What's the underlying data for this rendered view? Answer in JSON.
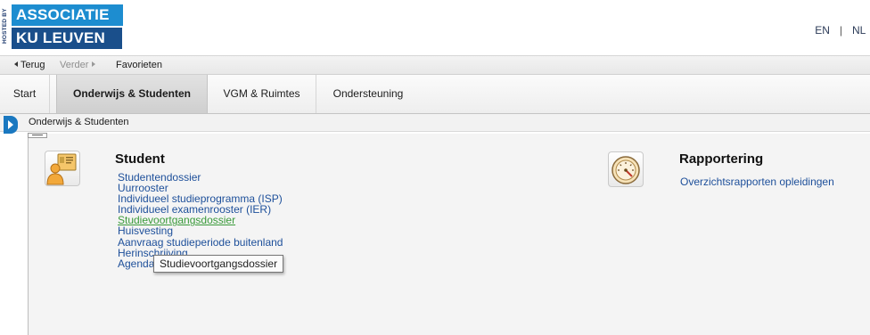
{
  "header": {
    "hosted_by": "HOSTED BY",
    "logo_line1": "ASSOCIATIE",
    "logo_line2": "KU LEUVEN",
    "languages": [
      "EN",
      "NL"
    ],
    "lang_separator": "|"
  },
  "navbar": {
    "back": "Terug",
    "forward": "Verder",
    "favorites": "Favorieten"
  },
  "tabs": [
    {
      "label": "Start",
      "active": false
    },
    {
      "label": "Onderwijs & Studenten",
      "active": true
    },
    {
      "label": "VGM & Ruimtes",
      "active": false
    },
    {
      "label": "Ondersteuning",
      "active": false
    }
  ],
  "breadcrumb": "Onderwijs & Studenten",
  "student": {
    "title": "Student",
    "icon": "student-badge-icon",
    "links": [
      "Studentendossier",
      "Uurrooster",
      "Individueel studieprogramma (ISP)",
      "Individueel examenrooster (IER)",
      "Studievoortgangsdossier",
      "Huisvesting",
      "Aanvraag studieperiode buitenland",
      "Herinschrijving",
      "Agenda sync"
    ],
    "hovered_index": 4
  },
  "reporting": {
    "title": "Rapportering",
    "icon": "gauge-icon",
    "links": [
      "Overzichtsrapporten opleidingen"
    ]
  },
  "tooltip": "Studievoortgangsdossier",
  "colors": {
    "logo_top": "#1d8dd0",
    "logo_bottom": "#1a4f8b",
    "link": "#1d4f9a",
    "link_hover": "#3a9a3a",
    "panel_toggle": "#1a78c0"
  }
}
